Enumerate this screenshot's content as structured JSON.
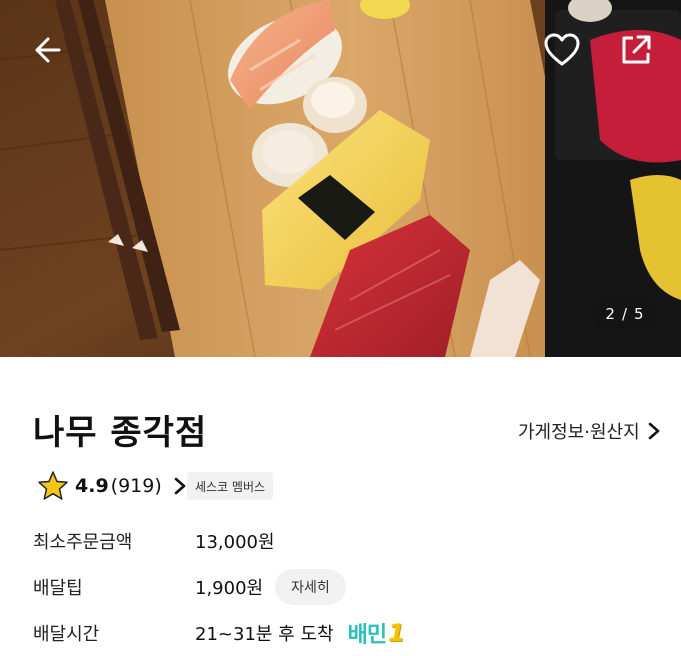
{
  "hero": {
    "pager_current": "2",
    "pager_sep": "/",
    "pager_total": "5"
  },
  "icons": {
    "back": "arrow-left-icon",
    "like": "heart-icon",
    "share": "share-external-icon",
    "star": "star-icon",
    "chevron": "chevron-right-icon"
  },
  "store": {
    "name": "나무 종각점",
    "info_link": "가게정보·원산지",
    "rating": "4.9",
    "review_count": "(919)",
    "badge": "세스코 멤버스"
  },
  "details": [
    {
      "label": "최소주문금액",
      "value": "13,000원"
    },
    {
      "label": "배달팁",
      "value": "1,900원",
      "button": "자세히"
    },
    {
      "label": "배달시간",
      "value": "21~31분 후 도착",
      "tag_main": "배민",
      "tag_num": "1"
    }
  ],
  "colors": {
    "star": "#f5c518",
    "baemin_mint": "#2ac1bc",
    "baemin_yellow": "#f4c300"
  }
}
